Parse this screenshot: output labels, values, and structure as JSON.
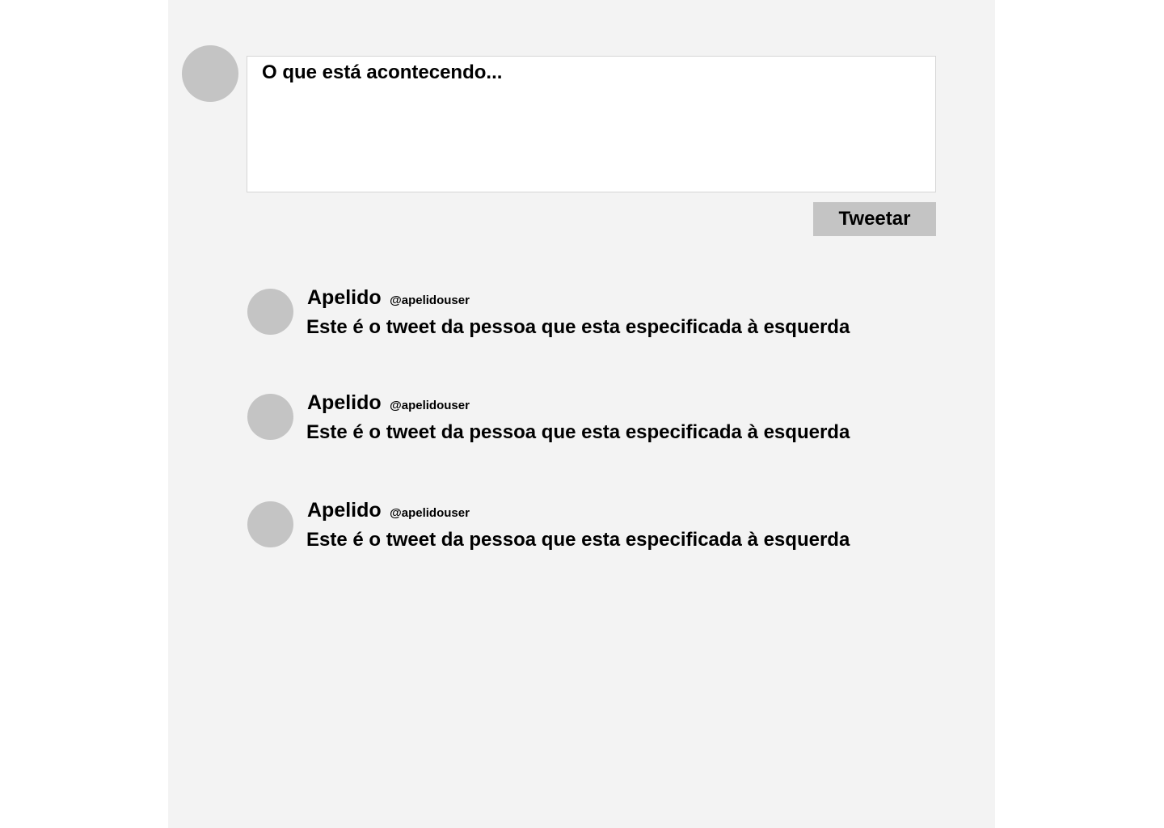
{
  "composer": {
    "placeholder": "O que está acontecendo...",
    "button_label": "Tweetar"
  },
  "tweets": [
    {
      "name": "Apelido",
      "handle": "@apelidouser",
      "text": "Este é o tweet da pessoa que esta especificada à esquerda"
    },
    {
      "name": "Apelido",
      "handle": "@apelidouser",
      "text": "Este é o tweet da pessoa que esta especificada à esquerda"
    },
    {
      "name": "Apelido",
      "handle": "@apelidouser",
      "text": "Este é o tweet da pessoa que esta especificada à esquerda"
    }
  ]
}
